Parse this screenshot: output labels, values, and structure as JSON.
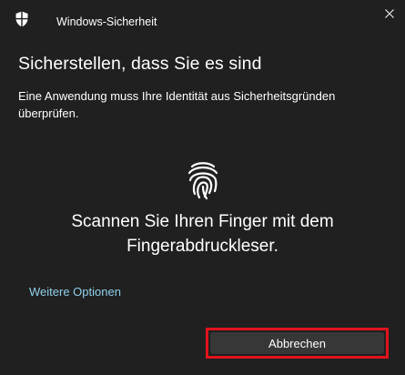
{
  "window": {
    "app_title": "Windows-Sicherheit",
    "close_glyph": "✕",
    "icon": "shield-icon"
  },
  "content": {
    "heading": "Sicherstellen, dass Sie es sind",
    "description": "Eine Anwendung muss Ihre Identität aus Sicherheitsgründen überprüfen.",
    "fingerprint_icon": "fingerprint-icon",
    "instruction_line1": "Scannen Sie Ihren Finger mit dem",
    "instruction_line2": "Fingerabdruckleser.",
    "more_options_label": "Weitere Optionen"
  },
  "actions": {
    "cancel_label": "Abbrechen"
  },
  "colors": {
    "background": "#202020",
    "link": "#8fd0ea",
    "button": "#373737",
    "highlight": "#e0141c"
  }
}
